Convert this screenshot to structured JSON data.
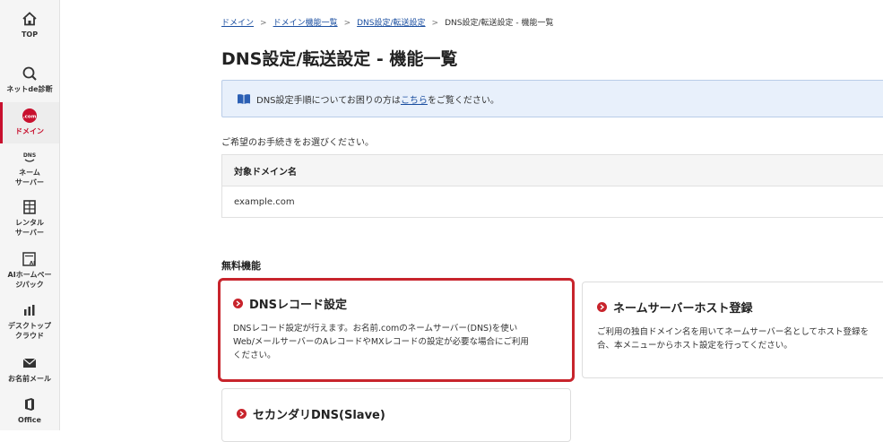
{
  "sidebar": {
    "items": [
      {
        "label": "TOP",
        "icon": "home-icon"
      },
      {
        "label": "ネットde診断",
        "icon": "magnifier-icon"
      },
      {
        "label": "ドメイン",
        "icon": "dotcom-icon"
      },
      {
        "label": "ネーム\nサーバー",
        "icon": "dns-icon"
      },
      {
        "label": "レンタル\nサーバー",
        "icon": "server-icon"
      },
      {
        "label": "AIホームペー\nジパック",
        "icon": "ai-page-icon"
      },
      {
        "label": "デスクトップ\nクラウド",
        "icon": "cloud-icon"
      },
      {
        "label": "お名前メール",
        "icon": "mail-icon"
      },
      {
        "label": "Office",
        "icon": "office-icon"
      }
    ]
  },
  "breadcrumb": {
    "items": [
      "ドメイン",
      "ドメイン機能一覧",
      "DNS設定/転送設定"
    ],
    "current": "DNS設定/転送設定 - 機能一覧"
  },
  "page": {
    "title": "DNS設定/転送設定 - 機能一覧",
    "info": {
      "before": "DNS設定手順についてお困りの方は",
      "link": "こちら",
      "after": "をご覧ください。"
    },
    "instruction": "ご希望のお手続きをお選びください。",
    "table": {
      "header": "対象ドメイン名",
      "value": "example.com"
    },
    "section_title": "無料機能"
  },
  "cards": [
    {
      "title": "DNSレコード設定",
      "description": "DNSレコード設定が行えます。お名前.comのネームサーバー(DNS)を使い\nWeb/メールサーバーのAレコードやMXレコードの設定が必要な場合にご利用\nください。"
    },
    {
      "title": "ネームサーバーホスト登録",
      "description": "ご利用の独自ドメイン名を用いてネームサーバー名としてホスト登録を\n合、本メニューからホスト設定を行ってください。"
    },
    {
      "title": "セカンダリDNS(Slave)",
      "description": ""
    }
  ],
  "colors": {
    "accent": "#c8242c",
    "link": "#1a4ea0",
    "info_bg": "#e8f0fb"
  }
}
